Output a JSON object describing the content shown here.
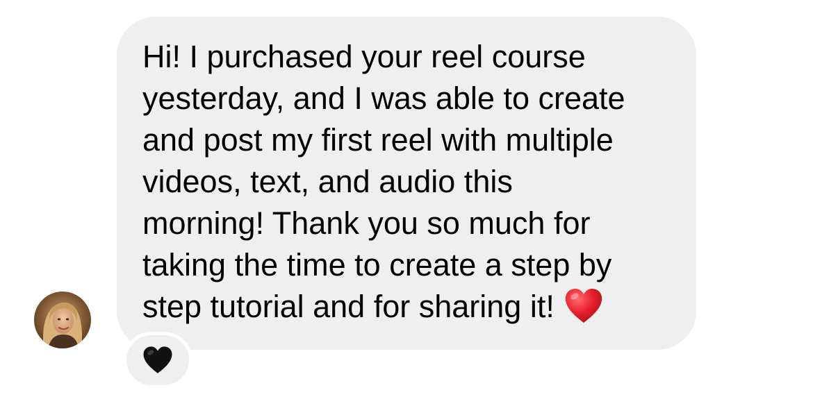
{
  "message": {
    "lines": [
      "Hi! I purchased your reel course",
      "yesterday, and I was able to create",
      "and post my first reel with multiple",
      "videos, text, and audio this",
      "morning! Thank you so much for",
      "taking the time to create a step by",
      "step tutorial and for sharing it!"
    ],
    "trailing_emoji": "red-heart-icon"
  },
  "reaction": {
    "emoji": "black-heart-icon"
  },
  "colors": {
    "bubble_background": "#efefef",
    "text": "#000000",
    "heart_red": "#e6202e",
    "heart_black": "#111111"
  }
}
